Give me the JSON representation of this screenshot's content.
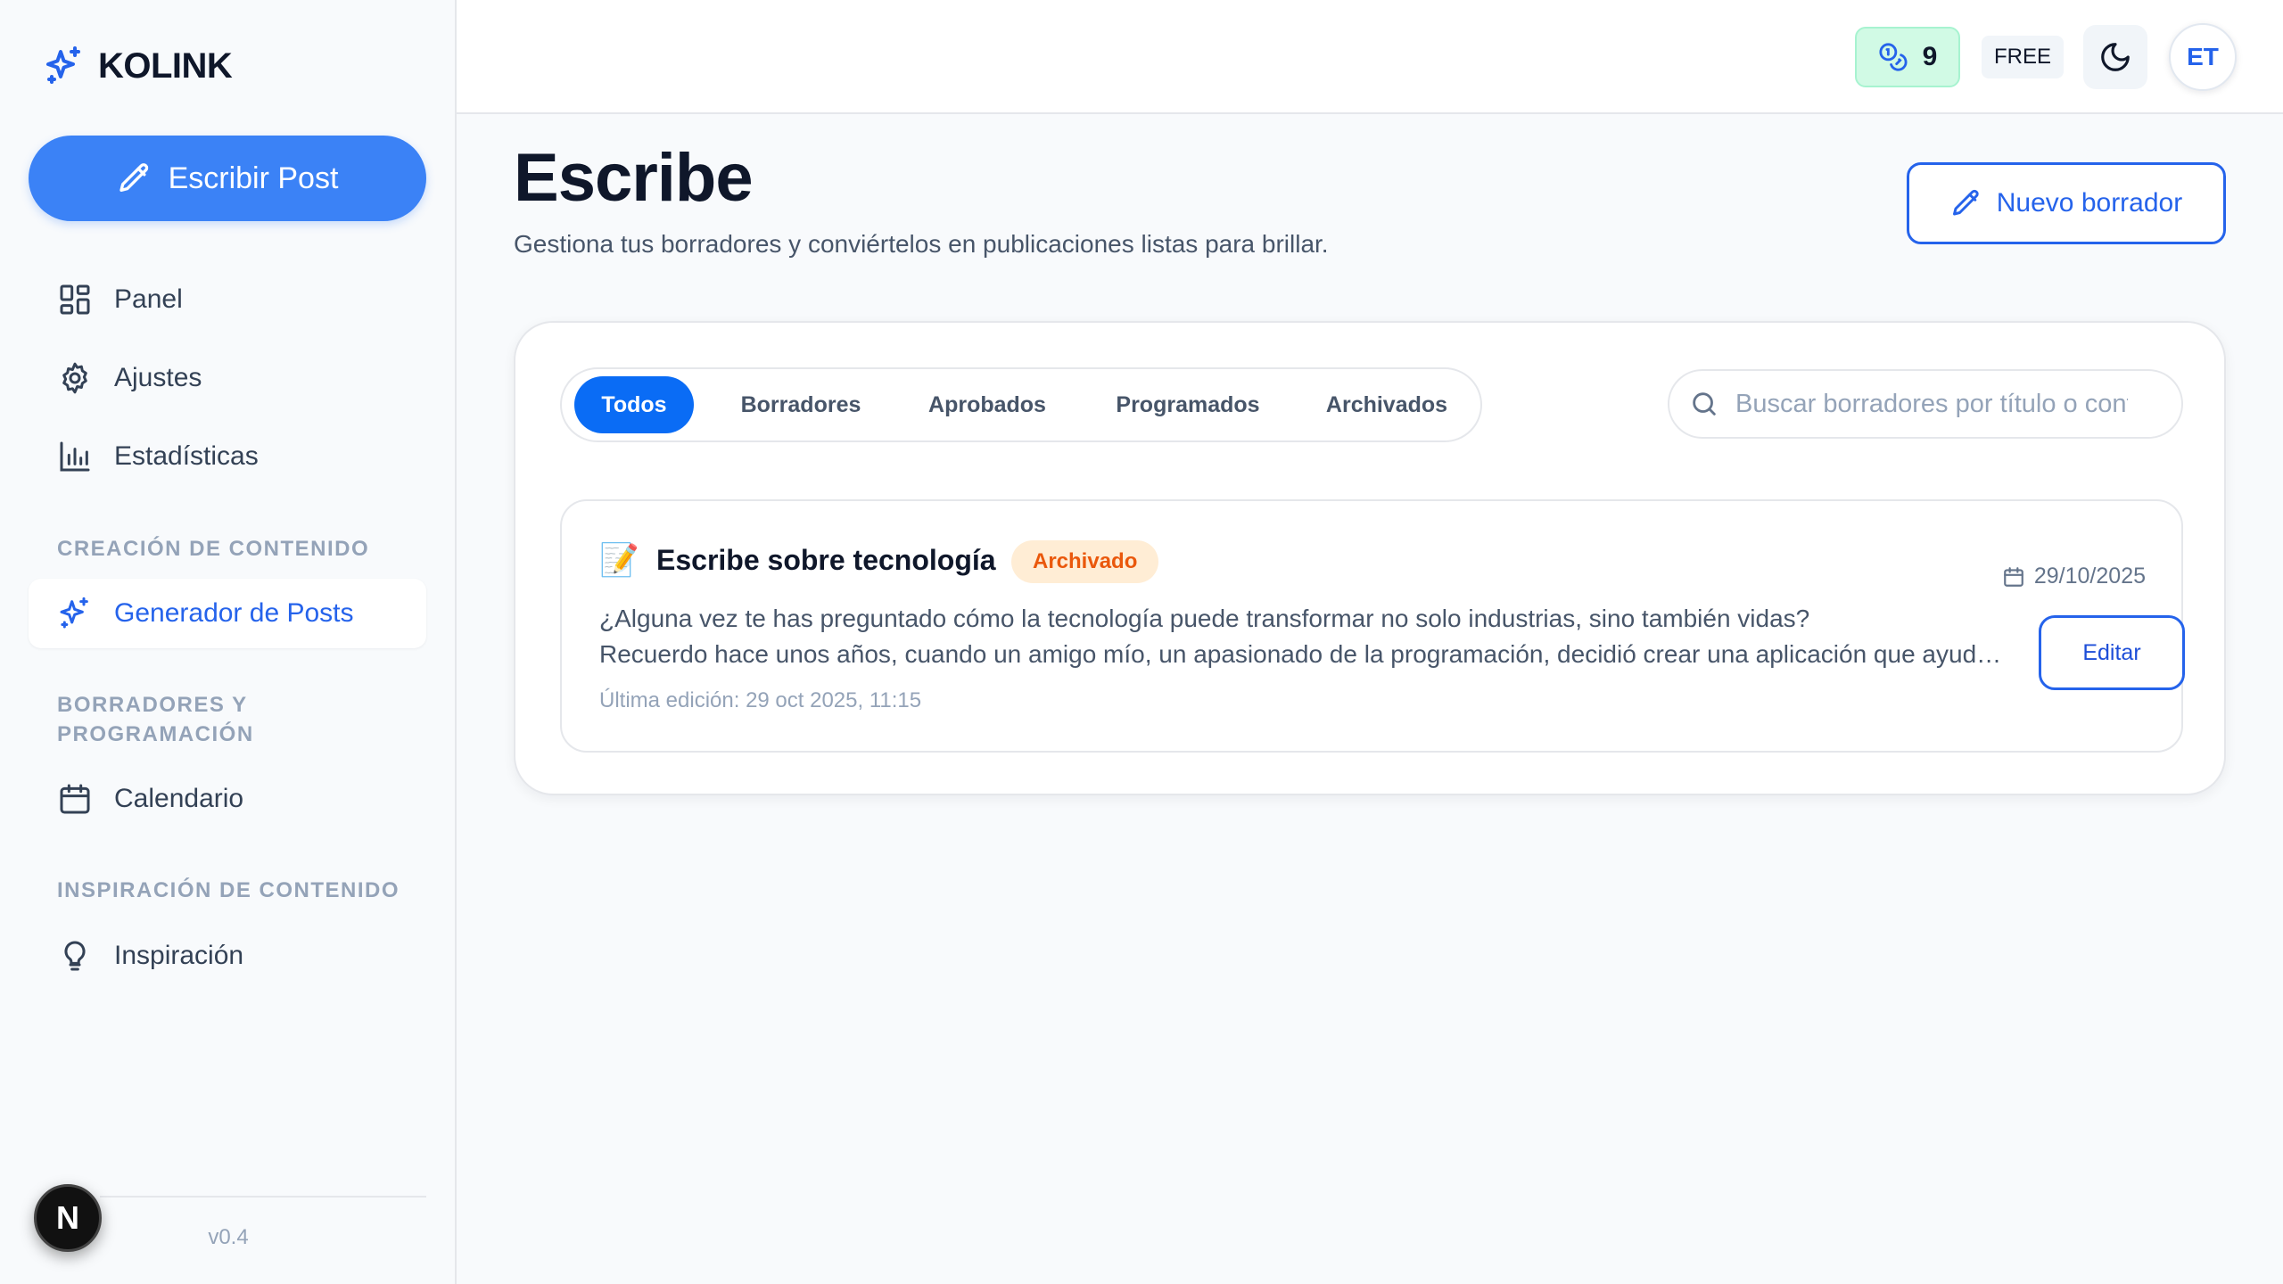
{
  "brand": {
    "name": "KOLINK"
  },
  "sidebar": {
    "write_button": "Escribir Post",
    "nav": [
      {
        "label": "Panel",
        "icon": "dashboard-icon"
      },
      {
        "label": "Ajustes",
        "icon": "gear-icon"
      },
      {
        "label": "Estadísticas",
        "icon": "bar-chart-icon"
      }
    ],
    "sections": [
      {
        "label": "CREACIÓN DE CONTENIDO",
        "items": [
          {
            "label": "Generador de Posts",
            "icon": "sparkles-icon",
            "active": true
          }
        ]
      },
      {
        "label": "BORRADORES Y PROGRAMACIÓN",
        "items": [
          {
            "label": "Calendario",
            "icon": "calendar-icon"
          }
        ]
      },
      {
        "label": "INSPIRACIÓN DE CONTENIDO",
        "items": [
          {
            "label": "Inspiración",
            "icon": "lightbulb-icon"
          }
        ]
      }
    ],
    "version": "v0.4",
    "dev_badge": "N"
  },
  "topbar": {
    "credits": "9",
    "plan": "FREE",
    "avatar_initials": "ET"
  },
  "main": {
    "title": "Escribe",
    "subtitle": "Gestiona tus borradores y conviértelos en publicaciones listas para brillar.",
    "new_draft_button": "Nuevo borrador",
    "tabs": [
      {
        "label": "Todos",
        "active": true
      },
      {
        "label": "Borradores"
      },
      {
        "label": "Aprobados"
      },
      {
        "label": "Programados"
      },
      {
        "label": "Archivados"
      }
    ],
    "search": {
      "placeholder": "Buscar borradores por título o contenido"
    },
    "drafts": [
      {
        "emoji": "📝",
        "title": "Escribe sobre tecnología",
        "status": "Archivado",
        "date": "29/10/2025",
        "excerpt_line1": "¿Alguna vez te has preguntado cómo la tecnología puede transformar no solo industrias, sino también vidas?",
        "excerpt_line2": "Recuerdo hace unos años, cuando un amigo mío, un apasionado de la programación, decidió crear una aplicación que ayudaba a personas",
        "last_edit": "Última edición: 29 oct 2025, 11:15",
        "edit_button": "Editar"
      }
    ]
  },
  "colors": {
    "accent": "#3b82f6",
    "accent_dark": "#2563eb",
    "status_archived_bg": "#ffedd5",
    "status_archived_text": "#ea580c",
    "credits_bg": "#d1fae5"
  }
}
